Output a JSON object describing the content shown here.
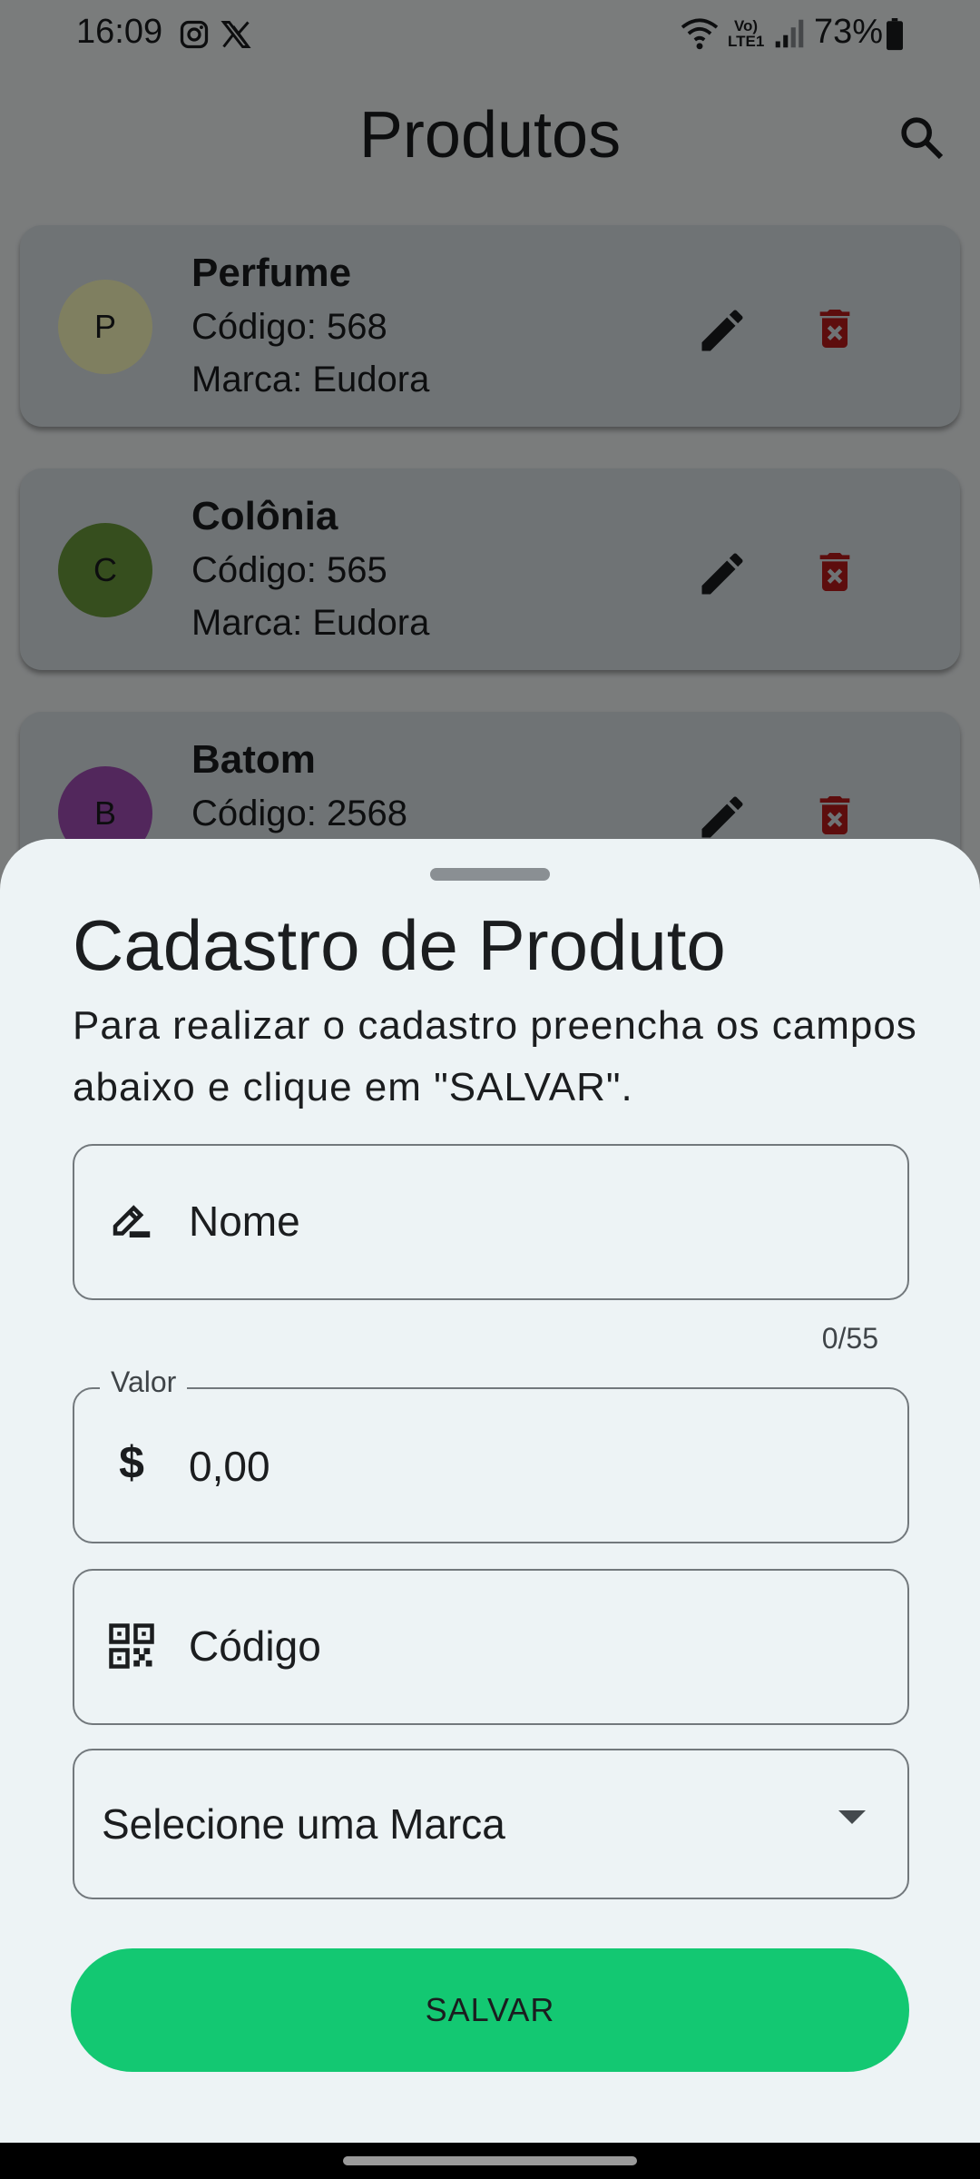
{
  "status_bar": {
    "time": "16:09",
    "battery": "73%",
    "network": "Vo) LTE1"
  },
  "app_bar": {
    "title": "Produtos"
  },
  "products": [
    {
      "initial": "P",
      "name": "Perfume",
      "code": "Código: 568",
      "brand": "Marca: Eudora",
      "avatar_color": "#ffffc0"
    },
    {
      "initial": "C",
      "name": "Colônia",
      "code": "Código: 565",
      "brand": "Marca: Eudora",
      "avatar_color": "#6c9c3c"
    },
    {
      "initial": "B",
      "name": "Batom",
      "code": "Código: 2568",
      "brand": "",
      "avatar_color": "#a44fb8"
    }
  ],
  "sheet": {
    "title": "Cadastro de Produto",
    "description": "Para realizar o cadastro preencha os campos abaixo e clique em \"SALVAR\".",
    "name_field": {
      "placeholder": "Nome",
      "counter": "0/55"
    },
    "value_field": {
      "label": "Valor",
      "value": "0,00"
    },
    "code_field": {
      "placeholder": "Código"
    },
    "brand_select": {
      "placeholder": "Selecione uma Marca"
    },
    "save_label": "SALVAR"
  },
  "colors": {
    "accent": "#13c872",
    "delete_icon": "#ba1a1a",
    "sheet_bg": "#edf3f5"
  }
}
